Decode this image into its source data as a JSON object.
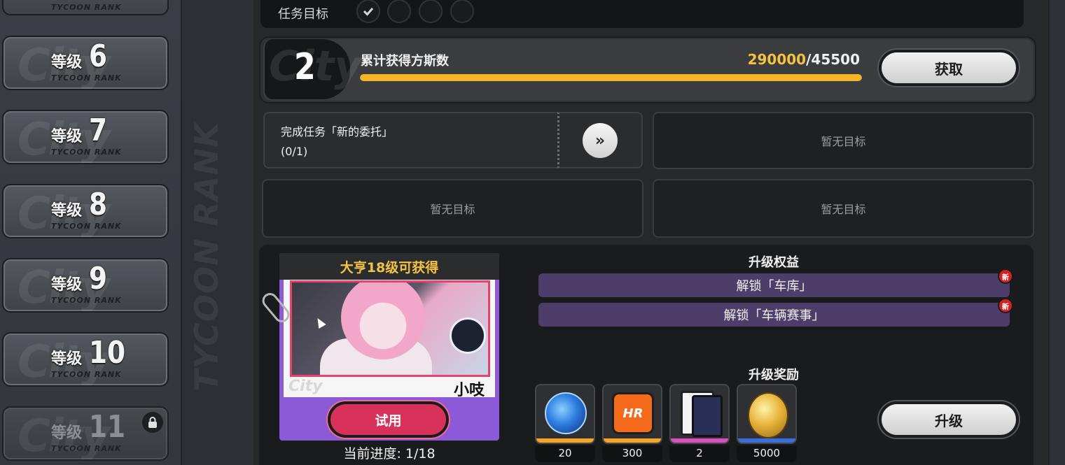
{
  "sidebar": {
    "rank_prefix": "等级",
    "rank_sub": "TYCOON RANK",
    "watermark": "City",
    "top_stub_sub": "TYCOON RANK",
    "items": [
      {
        "num": "6",
        "locked": false
      },
      {
        "num": "7",
        "locked": false
      },
      {
        "num": "8",
        "locked": false
      },
      {
        "num": "9",
        "locked": false
      },
      {
        "num": "10",
        "locked": false
      },
      {
        "num": "11",
        "locked": true
      }
    ]
  },
  "strip": {
    "text": "TYCOON RANK"
  },
  "task_goal": {
    "label": "任务目标",
    "completed": 1,
    "total": 4
  },
  "progress": {
    "level": "2",
    "badge_watermark": "City",
    "title": "累计获得方斯数",
    "current": "290000",
    "separator": "/",
    "target": "45500",
    "fill_fraction": 1.0,
    "claim_label": "获取"
  },
  "goals": {
    "task_title": "完成任务「新的委托」",
    "task_progress": "(0/1)",
    "go_icon": "»",
    "empty_label": "暂无目标"
  },
  "reward_card": {
    "header": "大亨18级可获得",
    "name": "小吱",
    "watermark": "City",
    "try_label": "试用",
    "progress_text": "当前进度: 1/18"
  },
  "perks": {
    "title": "升级权益",
    "new_badge": "新",
    "items": [
      "解锁「车库」",
      "解锁「车辆赛事」"
    ]
  },
  "rewards": {
    "title": "升级奖励",
    "hunter_text": "HR",
    "items": [
      {
        "icon": "blue-orb-icon",
        "qty": "20",
        "rarity_color": "#f5a623"
      },
      {
        "icon": "hunter-hunter-icon",
        "qty": "300",
        "rarity_color": "#f5a623"
      },
      {
        "icon": "cards-icon",
        "qty": "2",
        "rarity_color": "#d84fc2"
      },
      {
        "icon": "golden-egg-icon",
        "qty": "5000",
        "rarity_color": "#3a6fe0"
      }
    ],
    "upgrade_label": "升级"
  },
  "colors": {
    "accent_gold": "#f5c242",
    "progress_fill": "#f5b52a",
    "card_purple": "#8c5ad8",
    "try_red": "#d8315a",
    "perk_bg": "#4c3d69",
    "new_badge": "#d32222"
  }
}
